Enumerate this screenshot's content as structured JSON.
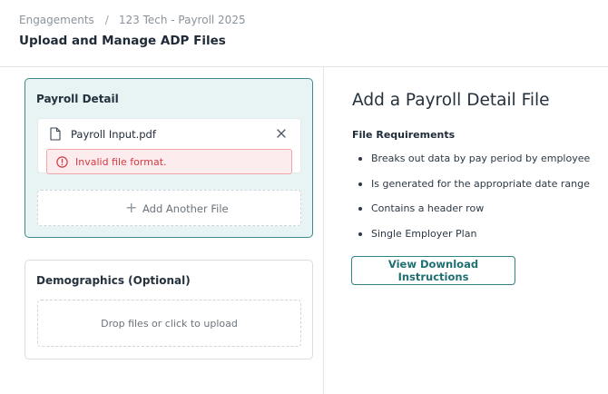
{
  "breadcrumb": {
    "items": [
      "Engagements",
      "123 Tech - Payroll 2025"
    ],
    "separator": "/"
  },
  "page_title": "Upload and Manage ADP Files",
  "payroll_card": {
    "title": "Payroll Detail",
    "file": {
      "name": "Payroll Input.pdf",
      "icon": "file-icon",
      "remove_icon": "close-icon"
    },
    "error": {
      "message": "Invalid file format.",
      "icon": "alert-circle-icon"
    },
    "add_another_label": "Add Another File"
  },
  "demographics_card": {
    "title": "Demographics (Optional)",
    "dropzone_label": "Drop files or click to upload"
  },
  "info_panel": {
    "title": "Add a Payroll Detail File",
    "requirements_heading": "File Requirements",
    "requirements": [
      "Breaks out data by pay period by employee",
      "Is generated for the appropriate date range",
      "Contains a header row",
      "Single Employer Plan"
    ],
    "button_label": "View Download Instructions"
  },
  "colors": {
    "accent": "#2f8487",
    "active_card_bg": "#e8f3f3",
    "error": "#d33a43",
    "error_bg": "#fdeced"
  }
}
